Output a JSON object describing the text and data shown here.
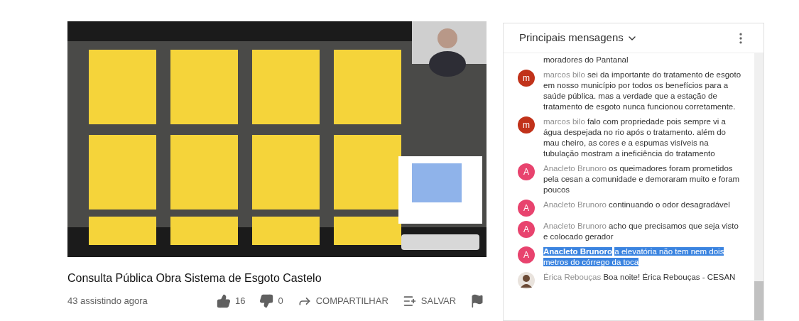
{
  "video": {
    "kind": "picture",
    "title": "Consulta Pública Obra Sistema de Esgoto Castelo",
    "viewers": "43 assistindo agora"
  },
  "actions": [
    {
      "kind": "like",
      "label": "16"
    },
    {
      "kind": "dislike",
      "label": "0"
    },
    {
      "kind": "share",
      "label": "COMPARTILHAR"
    },
    {
      "kind": "save",
      "label": "SALVAR"
    },
    {
      "kind": "flag"
    }
  ],
  "chat": {
    "title": "Principais mensagens",
    "continuation": "moradores do Pantanal",
    "messages": [
      {
        "avatar": {
          "kind": "letter",
          "letter": "m",
          "color": "#c1321a"
        },
        "author": "marcos bilo",
        "text": "sei da importante do tratamento de esgoto em nosso município por todos os benefícios para a saúde pública. mas a verdade que a estação de tratamento de esgoto nunca funcionou corretamente.",
        "selected": false
      },
      {
        "avatar": {
          "kind": "letter",
          "letter": "m",
          "color": "#c1321a"
        },
        "author": "marcos bilo",
        "text": "falo com propriedade pois sempre vi a água despejada no rio após o tratamento. além do mau cheiro, as cores e a espumas visíveis na tubulação mostram a ineficiência do tratamento",
        "selected": false
      },
      {
        "avatar": {
          "kind": "letter",
          "letter": "A",
          "color": "#e8436e"
        },
        "author": "Anacleto Brunoro",
        "text": "os queimadores foram prometidos pela cesan a comunidade e demoraram muito e foram poucos",
        "selected": false
      },
      {
        "avatar": {
          "kind": "letter",
          "letter": "A",
          "color": "#e8436e"
        },
        "author": "Anacleto Brunoro",
        "text": "continuando o odor desagradável",
        "selected": false
      },
      {
        "avatar": {
          "kind": "letter",
          "letter": "A",
          "color": "#e8436e"
        },
        "author": "Anacleto Brunoro",
        "text": "acho que precisamos que seja visto e colocado gerador",
        "selected": false
      },
      {
        "avatar": {
          "kind": "letter",
          "letter": "A",
          "color": "#e8436e"
        },
        "author": "Anacleto Brunoro",
        "text": "a elevatória não tem nem dois metros do córrego da toca",
        "selected": true
      },
      {
        "author": "Érica Rebouças",
        "text": "Boa noite! Érica Rebouças - CESAN",
        "selected": false
      }
    ]
  }
}
